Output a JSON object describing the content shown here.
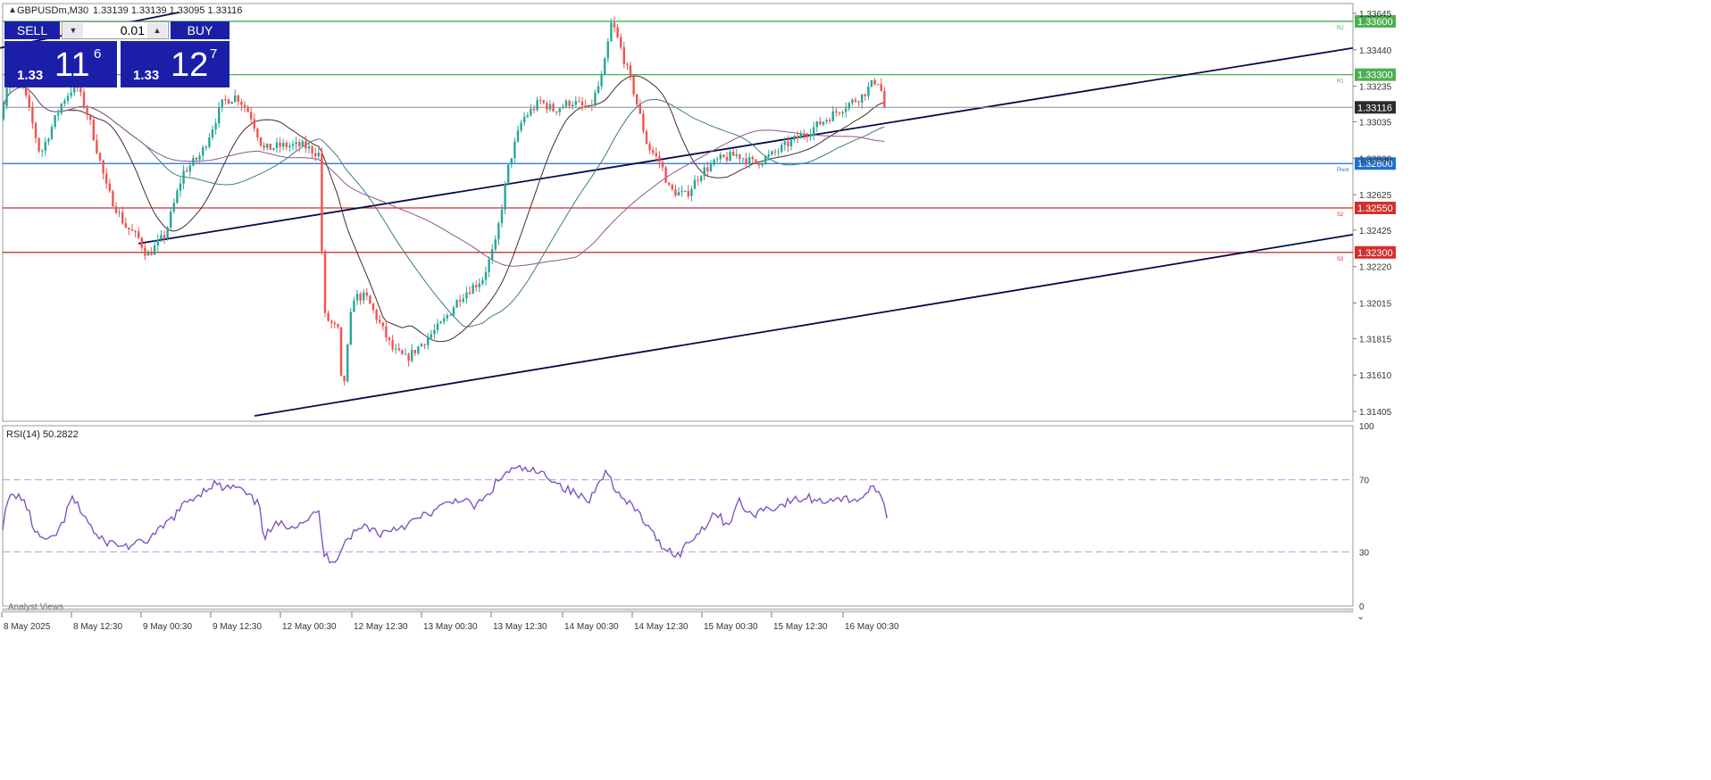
{
  "header": {
    "symbol_info": "GBPUSDm,M30",
    "ohlc": "1.33139 1.33139 1.33095 1.33116",
    "triangle": "▲"
  },
  "trade_panel": {
    "sell_label": "SELL",
    "buy_label": "BUY",
    "lot": "0.01",
    "down_arrow": "▼",
    "up_arrow": "▲",
    "sell_quote": {
      "prefix": "1.33",
      "big": "11",
      "sup": "6"
    },
    "buy_quote": {
      "prefix": "1.33",
      "big": "12",
      "sup": "7"
    }
  },
  "colors": {
    "bull": "#26a69a",
    "bear": "#ef5350",
    "resistance": "#4caf50",
    "pivot": "#1e6fd0",
    "support": "#d32f2f",
    "trend": "#0a0a4a",
    "rsi": "#7e57c2",
    "ma_fast": "#4a2a2a",
    "ma_mid": "#3c7f78",
    "ma_slow": "#8a5a8a"
  },
  "chart_data": {
    "type": "candlestick",
    "symbol": "GBPUSDm",
    "timeframe": "M30",
    "ylim": [
      1.3135,
      1.337
    ],
    "price_ticks": [
      "1.33645",
      "1.33440",
      "1.33235",
      "1.33035",
      "1.32830",
      "1.32625",
      "1.32425",
      "1.32220",
      "1.32015",
      "1.31815",
      "1.31610",
      "1.31405"
    ],
    "x_ticks": [
      "8 May 2025",
      "8 May 12:30",
      "9 May 00:30",
      "9 May 12:30",
      "12 May 00:30",
      "12 May 12:30",
      "13 May 00:30",
      "13 May 12:30",
      "14 May 00:30",
      "14 May 12:30",
      "15 May 00:30",
      "15 May 12:30",
      "16 May 00:30"
    ],
    "levels": [
      {
        "name": "R2",
        "price": 1.336,
        "label": "1.33600",
        "kind": "resistance"
      },
      {
        "name": "R1",
        "price": 1.333,
        "label": "1.33300",
        "kind": "resistance"
      },
      {
        "name": "Pivot",
        "price": 1.328,
        "label": "1.32800",
        "kind": "pivot"
      },
      {
        "name": "S2",
        "price": 1.3255,
        "label": "1.32550",
        "kind": "support"
      },
      {
        "name": "S3",
        "price": 1.323,
        "label": "1.32300",
        "kind": "support"
      }
    ],
    "current_price": 1.33116,
    "current_price_label": "1.33116",
    "price_keypoints": [
      [
        0,
        1.3305
      ],
      [
        8,
        1.3325
      ],
      [
        25,
        1.3325
      ],
      [
        45,
        1.3285
      ],
      [
        70,
        1.3315
      ],
      [
        85,
        1.3325
      ],
      [
        100,
        1.3305
      ],
      [
        120,
        1.3265
      ],
      [
        140,
        1.3245
      ],
      [
        155,
        1.3238
      ],
      [
        165,
        1.3228
      ],
      [
        185,
        1.324
      ],
      [
        205,
        1.3275
      ],
      [
        225,
        1.3285
      ],
      [
        250,
        1.3315
      ],
      [
        265,
        1.3318
      ],
      [
        280,
        1.3308
      ],
      [
        295,
        1.3288
      ],
      [
        315,
        1.329
      ],
      [
        340,
        1.329
      ],
      [
        358,
        1.3285
      ],
      [
        362,
        1.3195
      ],
      [
        380,
        1.3185
      ],
      [
        383,
        1.3145
      ],
      [
        395,
        1.3205
      ],
      [
        410,
        1.3205
      ],
      [
        425,
        1.319
      ],
      [
        440,
        1.3175
      ],
      [
        455,
        1.317
      ],
      [
        475,
        1.318
      ],
      [
        495,
        1.319
      ],
      [
        515,
        1.3205
      ],
      [
        540,
        1.3215
      ],
      [
        555,
        1.3235
      ],
      [
        570,
        1.328
      ],
      [
        585,
        1.3305
      ],
      [
        605,
        1.3315
      ],
      [
        620,
        1.331
      ],
      [
        640,
        1.3315
      ],
      [
        660,
        1.331
      ],
      [
        675,
        1.333
      ],
      [
        685,
        1.336
      ],
      [
        695,
        1.3345
      ],
      [
        710,
        1.332
      ],
      [
        725,
        1.329
      ],
      [
        740,
        1.328
      ],
      [
        750,
        1.3265
      ],
      [
        768,
        1.3262
      ],
      [
        785,
        1.3275
      ],
      [
        805,
        1.3282
      ],
      [
        825,
        1.3285
      ],
      [
        845,
        1.328
      ],
      [
        865,
        1.3285
      ],
      [
        885,
        1.3292
      ],
      [
        905,
        1.3298
      ],
      [
        925,
        1.3305
      ],
      [
        945,
        1.3312
      ],
      [
        965,
        1.3318
      ],
      [
        982,
        1.3328
      ],
      [
        993,
        1.33116
      ]
    ],
    "trend_lines": [
      {
        "from": [
          0,
          1.3345
        ],
        "to": [
          200,
          1.3365
        ]
      },
      {
        "from": [
          155,
          1.3235
        ],
        "to": [
          1515,
          1.3345
        ]
      },
      {
        "from": [
          285,
          1.3138
        ],
        "to": [
          1515,
          1.324
        ]
      }
    ],
    "rsi": {
      "label": "RSI(14) 50.2822",
      "period": 14,
      "value": 50.2822,
      "ylim": [
        0,
        100
      ],
      "ticks": [
        "100",
        "70",
        "30",
        "0"
      ],
      "levels": [
        30,
        70
      ],
      "keypoints": [
        [
          0,
          38
        ],
        [
          10,
          60
        ],
        [
          20,
          62
        ],
        [
          30,
          55
        ],
        [
          40,
          40
        ],
        [
          55,
          35
        ],
        [
          70,
          45
        ],
        [
          80,
          60
        ],
        [
          95,
          50
        ],
        [
          110,
          37
        ],
        [
          125,
          35
        ],
        [
          140,
          33
        ],
        [
          160,
          35
        ],
        [
          175,
          40
        ],
        [
          195,
          50
        ],
        [
          210,
          58
        ],
        [
          225,
          63
        ],
        [
          240,
          68
        ],
        [
          250,
          65
        ],
        [
          265,
          66
        ],
        [
          280,
          60
        ],
        [
          292,
          55
        ],
        [
          295,
          38
        ],
        [
          310,
          45
        ],
        [
          330,
          45
        ],
        [
          350,
          50
        ],
        [
          358,
          52
        ],
        [
          362,
          28
        ],
        [
          375,
          25
        ],
        [
          385,
          35
        ],
        [
          395,
          40
        ],
        [
          410,
          45
        ],
        [
          425,
          40
        ],
        [
          440,
          43
        ],
        [
          455,
          45
        ],
        [
          475,
          50
        ],
        [
          495,
          55
        ],
        [
          515,
          60
        ],
        [
          530,
          55
        ],
        [
          545,
          60
        ],
        [
          555,
          68
        ],
        [
          570,
          75
        ],
        [
          585,
          76
        ],
        [
          600,
          74
        ],
        [
          615,
          72
        ],
        [
          630,
          66
        ],
        [
          645,
          62
        ],
        [
          660,
          58
        ],
        [
          672,
          72
        ],
        [
          680,
          74
        ],
        [
          695,
          60
        ],
        [
          715,
          52
        ],
        [
          730,
          40
        ],
        [
          745,
          32
        ],
        [
          760,
          28
        ],
        [
          770,
          35
        ],
        [
          785,
          42
        ],
        [
          800,
          52
        ],
        [
          815,
          45
        ],
        [
          828,
          58
        ],
        [
          840,
          50
        ],
        [
          855,
          54
        ],
        [
          870,
          55
        ],
        [
          885,
          58
        ],
        [
          905,
          60
        ],
        [
          920,
          58
        ],
        [
          935,
          60
        ],
        [
          950,
          59
        ],
        [
          965,
          60
        ],
        [
          980,
          67
        ],
        [
          993,
          50.3
        ]
      ]
    }
  },
  "footer": {
    "analyst_views": "Analyst Views",
    "collapse_icon": "‹",
    "scroll_icon": "⌄"
  }
}
